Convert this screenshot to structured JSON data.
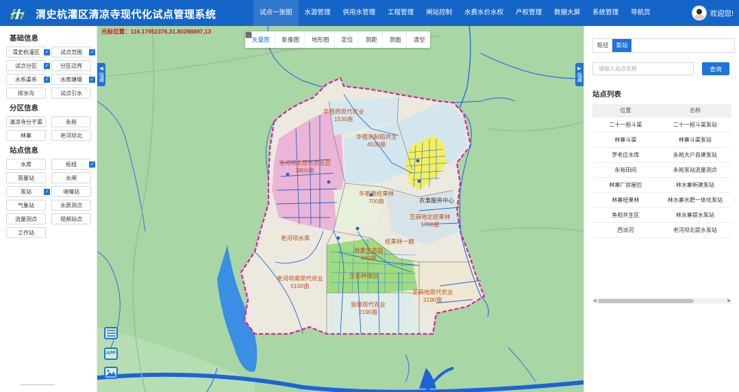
{
  "header": {
    "title": "渭史杭灌区清凉寺现代化试点管理系统",
    "nav": [
      "试点一张图",
      "水源管理",
      "供用水管理",
      "工程管理",
      "闸站控制",
      "水费水价水权",
      "产权管理",
      "数据大屏",
      "系统管理",
      "导航页"
    ],
    "active_nav": 0,
    "greeting": "欢迎您!"
  },
  "left_panel": {
    "sections": [
      {
        "title": "基础信息",
        "items": [
          {
            "label": "渭史杭灌区",
            "checked": true
          },
          {
            "label": "试点范围",
            "checked": true
          },
          {
            "label": "试点分区",
            "checked": true
          },
          {
            "label": "分区边界",
            "checked": false
          },
          {
            "label": "水系渠系",
            "checked": true
          },
          {
            "label": "水库塘堰",
            "checked": true
          },
          {
            "label": "排水沟",
            "checked": false
          },
          {
            "label": "试点引水",
            "checked": false
          }
        ]
      },
      {
        "title": "分区信息",
        "items": [
          {
            "label": "清凉寺分干渠",
            "checked": false
          },
          {
            "label": "永裕",
            "checked": false
          },
          {
            "label": "林寨",
            "checked": false
          },
          {
            "label": "老河坝北",
            "checked": false
          }
        ]
      },
      {
        "title": "站点信息",
        "items": [
          {
            "label": "水库",
            "checked": false
          },
          {
            "label": "枢纽",
            "checked": true
          },
          {
            "label": "雨量站",
            "checked": false
          },
          {
            "label": "水闸",
            "checked": false
          },
          {
            "label": "泵站",
            "checked": true
          },
          {
            "label": "墒情站",
            "checked": false
          },
          {
            "label": "气象站",
            "checked": false
          },
          {
            "label": "水质测点",
            "checked": false
          },
          {
            "label": "流量测点",
            "checked": false
          },
          {
            "label": "视频站点",
            "checked": false
          },
          {
            "label": "工作站",
            "checked": false
          }
        ]
      }
    ]
  },
  "map": {
    "coordinate_label": "光标位置：",
    "coordinate_value": "116.17952376,31.80288897,13",
    "tools": [
      {
        "label": "矢量图",
        "icon": "globe-icon",
        "active": true
      },
      {
        "label": "影像图",
        "icon": "earth-icon",
        "active": false
      },
      {
        "label": "地形图",
        "icon": "terrain-icon",
        "active": false
      },
      {
        "label": "定位",
        "icon": "locate-icon",
        "active": false
      },
      {
        "label": "测距",
        "icon": "ruler-icon",
        "active": false
      },
      {
        "label": "测面",
        "icon": "area-icon",
        "active": false
      },
      {
        "label": "清空",
        "icon": "trash-icon",
        "active": false
      }
    ],
    "collapse_left_label": "隐藏",
    "collapse_right_label": "隐藏",
    "side_tools": {
      "app": "APP"
    },
    "zones": [
      {
        "name": "华祖西现代农业",
        "area": "1530亩"
      },
      {
        "name": "华祖东斛稻共生",
        "area": "4530亩"
      },
      {
        "name": "老河坝北现代农业区",
        "area": "3800亩"
      },
      {
        "name": "华祖南经果林",
        "area": "700亩"
      },
      {
        "name": "芝麻地北经果林",
        "area": "1700亩"
      },
      {
        "name": "农事服务中心",
        "area": ""
      },
      {
        "name": "经果林一期",
        "area": ""
      },
      {
        "name": "林寨生态园",
        "area": "440亩"
      },
      {
        "name": "生态种植区",
        "area": ""
      },
      {
        "name": "老河坝南现代农业",
        "area": "5100亩"
      },
      {
        "name": "老河坝水库",
        "area": ""
      },
      {
        "name": "张墩现代农业",
        "area": "2190亩"
      },
      {
        "name": "芝麻地现代农业",
        "area": "2190亩"
      }
    ]
  },
  "right_panel": {
    "tabs": [
      "枢纽",
      "泵站"
    ],
    "active_tab": 1,
    "search_placeholder": "请输入站点名称",
    "query_button": "查询",
    "list_title": "站点列表",
    "columns": [
      "位置",
      "名称"
    ],
    "rows": [
      [
        "二十一担斗渠",
        "二十一担斗渠泵站"
      ],
      [
        "林寨斗渠",
        "林寨斗渠泵站"
      ],
      [
        "罗老庄水库",
        "永裕大户自建泵站"
      ],
      [
        "永裕田间",
        "永裕泵站流量测点"
      ],
      [
        "林寨厂房屋后",
        "林水寨新建泵站"
      ],
      [
        "林寨经果林",
        "林水寨水肥一体化泵站"
      ],
      [
        "鱼稻共生区",
        "林水寨提水泵站"
      ],
      [
        "西派河",
        "老河坝北提水泵站"
      ]
    ]
  }
}
